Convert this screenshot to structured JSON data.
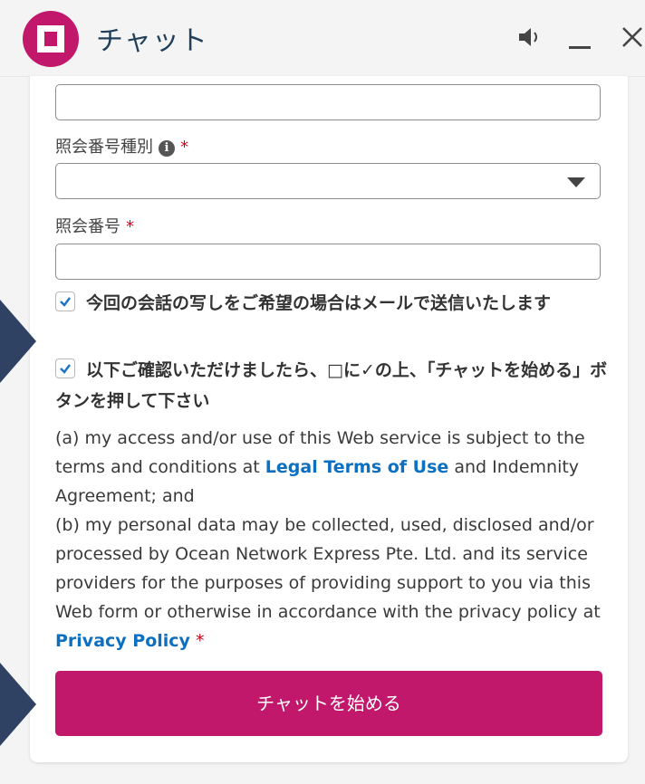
{
  "header": {
    "title": "チャット",
    "speaker_icon": "speaker-icon",
    "minimize_icon": "minimize-icon",
    "close_icon": "close-icon"
  },
  "form": {
    "top_field": {
      "value": ""
    },
    "reference_type": {
      "label": "照会番号種別",
      "required_mark": "*",
      "info_icon": "info-icon",
      "selected": ""
    },
    "reference_number": {
      "label": "照会番号",
      "required_mark": "*",
      "value": ""
    },
    "checkbox_email": {
      "checked": true,
      "label": "今回の会話の写しをご希望の場合はメールで送信いたします"
    },
    "checkbox_confirm": {
      "checked": true,
      "label": "以下ご確認いただけましたら、□に✓の上、「チャットを始める」ボタンを押して下さい"
    },
    "legal": {
      "text_a_before": "(a) my access and/or use of this Web service is subject to the terms and conditions at ",
      "link_terms": "Legal Terms of Use",
      "text_a_after": " and Indemnity Agreement; and",
      "text_b": "(b) my personal data may be collected, used, disclosed and/or processed by Ocean Network Express Pte. Ltd. and its service providers for the purposes of providing support to you via this Web form or otherwise in accordance with the privacy policy at ",
      "link_privacy": "Privacy Policy",
      "required_mark": "*"
    },
    "start_button": "チャットを始める"
  },
  "colors": {
    "brand": "#c2186b",
    "link": "#0b6fc2",
    "required": "#d0021b",
    "pointer_arrow": "#2f4264"
  }
}
